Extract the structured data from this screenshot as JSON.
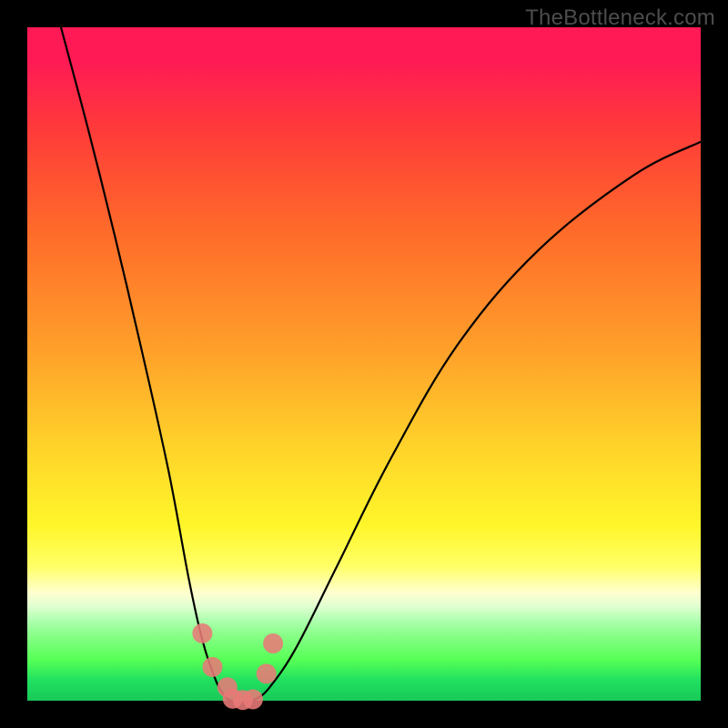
{
  "watermark": "TheBottleneck.com",
  "chart_data": {
    "type": "line",
    "title": "",
    "xlabel": "",
    "ylabel": "",
    "xlim": [
      0,
      100
    ],
    "ylim": [
      0,
      100
    ],
    "grid": false,
    "series": [
      {
        "name": "left-arm",
        "x": [
          5,
          9,
          13,
          17,
          21,
          24,
          26,
          28,
          29.5,
          30.5
        ],
        "y": [
          100,
          85,
          69,
          52,
          34,
          18,
          9,
          3,
          0.5,
          0
        ]
      },
      {
        "name": "right-arm",
        "x": [
          33,
          34,
          36,
          40,
          46,
          54,
          64,
          76,
          90,
          100
        ],
        "y": [
          0,
          0.3,
          2,
          8,
          20,
          36,
          53,
          67,
          78,
          83
        ]
      }
    ],
    "markers": [
      {
        "name": "marker-left-a",
        "x": 26,
        "y": 10,
        "color": "#e87a78"
      },
      {
        "name": "marker-left-b",
        "x": 27.5,
        "y": 5,
        "color": "#e87a78"
      },
      {
        "name": "marker-left-c",
        "x": 29.7,
        "y": 2,
        "color": "#e87a78"
      },
      {
        "name": "marker-bottom-a",
        "x": 30.5,
        "y": 0.3,
        "color": "#e87a78"
      },
      {
        "name": "marker-bottom-b",
        "x": 32,
        "y": 0.1,
        "color": "#e87a78"
      },
      {
        "name": "marker-bottom-c",
        "x": 33.5,
        "y": 0.2,
        "color": "#e87a78"
      },
      {
        "name": "marker-right-a",
        "x": 35.5,
        "y": 4,
        "color": "#e87a78"
      },
      {
        "name": "marker-right-b",
        "x": 36.5,
        "y": 8.5,
        "color": "#e87a78"
      }
    ],
    "colors": {
      "curve": "#000000",
      "marker": "#e87a78",
      "gradient_top": "#ff1a55",
      "gradient_bottom": "#18c858"
    }
  }
}
